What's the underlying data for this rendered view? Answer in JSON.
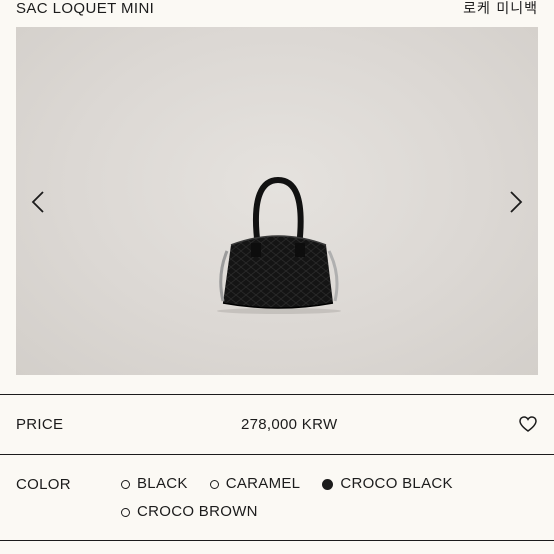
{
  "product": {
    "name_en": "SAC LOQUET MINI",
    "name_kr": "로케 미니백"
  },
  "gallery": {
    "prev_icon": "chevron-left-icon",
    "next_icon": "chevron-right-icon",
    "image_alt": "black croco handbag"
  },
  "price": {
    "label": "PRICE",
    "value": "278,000 KRW",
    "wishlist_icon": "heart-icon"
  },
  "color": {
    "label": "COLOR",
    "options": [
      {
        "label": "BLACK",
        "selected": false
      },
      {
        "label": "CARAMEL",
        "selected": false
      },
      {
        "label": "CROCO BLACK",
        "selected": true
      },
      {
        "label": "CROCO BROWN",
        "selected": false
      }
    ]
  }
}
